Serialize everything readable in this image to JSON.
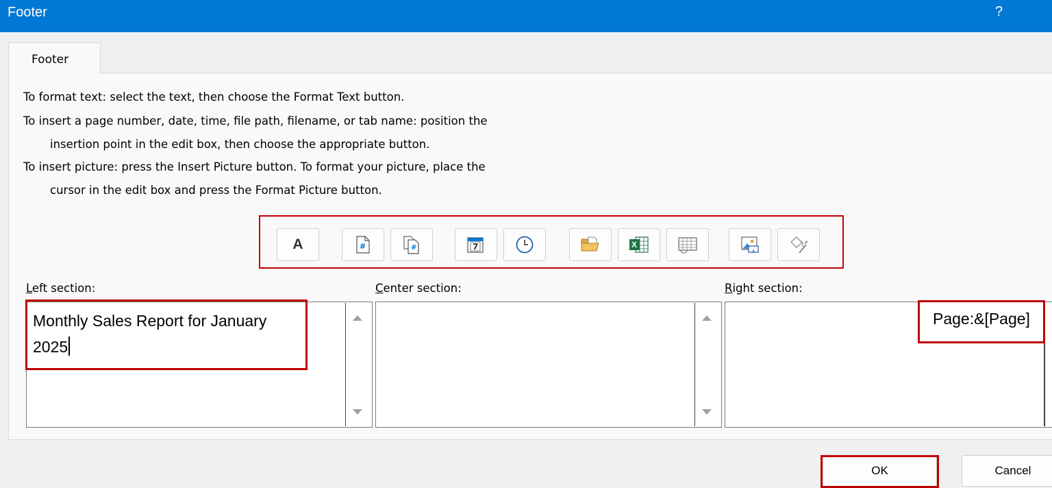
{
  "window": {
    "title": "Footer",
    "help_label": "?"
  },
  "tabs": [
    {
      "label": "Footer"
    }
  ],
  "instructions": [
    "To format text:  select the text, then choose the Format Text button.",
    "To insert a page number, date, time, file path, filename, or tab name:  position the",
    "insertion point in the edit box, then choose the appropriate button.",
    "To insert picture: press the Insert Picture button.  To format your picture, place the",
    "cursor in the edit box and press the Format Picture button."
  ],
  "toolbar": [
    {
      "name": "format-text",
      "icon": "letter-a-icon",
      "glyph": "A"
    },
    {
      "name": "insert-page-number",
      "icon": "page-number-icon",
      "glyph": "#"
    },
    {
      "name": "insert-number-of-pages",
      "icon": "number-of-pages-icon",
      "glyph": "#"
    },
    {
      "name": "insert-date",
      "icon": "calendar-icon",
      "glyph": "7"
    },
    {
      "name": "insert-time",
      "icon": "clock-icon"
    },
    {
      "name": "insert-file-path",
      "icon": "folder-icon"
    },
    {
      "name": "insert-file-name",
      "icon": "excel-icon",
      "glyph": "X"
    },
    {
      "name": "insert-sheet-name",
      "icon": "sheet-grid-icon"
    },
    {
      "name": "insert-picture",
      "icon": "picture-icon"
    },
    {
      "name": "format-picture",
      "icon": "format-picture-icon"
    }
  ],
  "sections": {
    "left": {
      "label_key": "L",
      "label_rest": "eft section:",
      "text_line1": "Monthly Sales Report for January",
      "text_line2": "2025"
    },
    "center": {
      "label_key": "C",
      "label_rest": "enter section:",
      "text": ""
    },
    "right": {
      "label_key": "R",
      "label_rest": "ight section:",
      "text": "Page:&[Page]"
    }
  },
  "buttons": {
    "ok": "OK",
    "cancel": "Cancel"
  },
  "colors": {
    "title_bar": "#0078d4",
    "highlight": "#c00000",
    "background": "#f0f0f0"
  }
}
